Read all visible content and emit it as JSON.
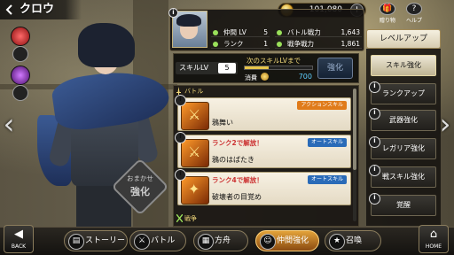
{
  "header": {
    "title": "クロウ",
    "coins": "101,080",
    "coin_plus": "+",
    "gift_label": "贈り物",
    "gift_glyph": "🎁",
    "help_label": "ヘルプ",
    "help_glyph": "?"
  },
  "status": {
    "info_glyph": "i",
    "rows": [
      {
        "label": "仲間 LV",
        "value": "5"
      },
      {
        "label": "ランク",
        "value": "1"
      }
    ],
    "rows_right": [
      {
        "label": "バトル戦力",
        "value": "1,643"
      },
      {
        "label": "戦争戦力",
        "value": "1,861"
      }
    ]
  },
  "skill": {
    "lv_label": "スキルLV",
    "lv_value": "5",
    "until_label": "次のスキルLVまで",
    "progress": 0.35,
    "cost_label": "消費",
    "cost_value": "700",
    "strengthen_label": "強化"
  },
  "list": {
    "section1": "バトル",
    "section2": "戦争",
    "items": [
      {
        "unlock": "",
        "name": "鴉舞い",
        "tag": "アクションスキル",
        "tag_type": "action",
        "glyph": "⚔"
      },
      {
        "unlock": "ランク2で解放！",
        "name": "鴉のはばたき",
        "tag": "オートスキル",
        "tag_type": "auto",
        "glyph": "⚔"
      },
      {
        "unlock": "ランク4で解放！",
        "name": "破壊者の目覚め",
        "tag": "オートスキル",
        "tag_type": "auto",
        "glyph": "✦"
      }
    ]
  },
  "omakase": {
    "line1": "おまかせ",
    "line2": "強化"
  },
  "menu": {
    "levelup": "レベルアップ",
    "items": [
      {
        "label": "スキル強化",
        "active": true
      },
      {
        "label": "ランクアップ",
        "active": false
      },
      {
        "label": "武器強化",
        "active": false
      },
      {
        "label": "レガリア強化",
        "active": false
      },
      {
        "label": "戦スキル強化",
        "active": false
      },
      {
        "label": "覚醒",
        "active": false
      }
    ]
  },
  "nav": {
    "back_label": "BACK",
    "back_glyph": "◀",
    "home_label": "HOME",
    "home_glyph": "⌂",
    "left_arrow": "‹",
    "right_arrow": "›",
    "story": "ストーリー",
    "battle": "バトル",
    "castle": "方舟",
    "ally": "仲間強化",
    "summon": "召喚"
  },
  "colors": {
    "accent": "#e3a33a",
    "progress": "#e7c54a",
    "cost": "#5fd0ff"
  }
}
